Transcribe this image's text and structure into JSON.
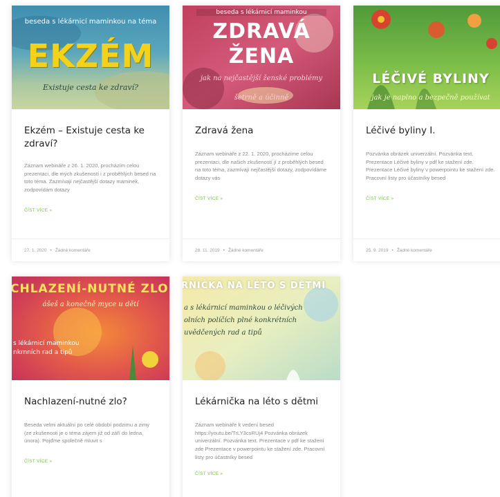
{
  "posts": [
    {
      "image": {
        "line1": "beseda s lékárnicí maminkou na téma",
        "big": "EKZÉM",
        "line2": "Existuje cesta ke zdraví?"
      },
      "title": "Ekzém – Existuje cesta ke zdraví?",
      "excerpt": "Záznam webináře z 26. 1. 2020, procházím celou prezentaci, dle mých zkušeností i z proběhlých besed na toto téma. Zazmívají nejčastější dotazy maminek, zodpovídám dotazy",
      "read_more": "ČÍST VÍCE »",
      "date": "27. 1. 2020",
      "comments": "Žádné komentáře"
    },
    {
      "image": {
        "line1": "beseda s lékárnicí maminkou",
        "big1": "ZDRAVÁ",
        "big2": "ŽENA",
        "line2": "jak na nejčastější ženské problémy",
        "line3": "šetrně a účinně"
      },
      "title": "Zdravá žena",
      "excerpt": "Záznam webináře z 22. 1. 2020, procházíme celou prezentaci, dle našich zkušeností jí z proběhlých besed na toto téma, zazmívají nejčastější dotazy, zodpovídáme dotazy vás",
      "read_more": "ČÍST VÍCE »",
      "date": "28. 11. 2019",
      "comments": "Žádné komentáře"
    },
    {
      "image": {
        "big": "LÉČIVÉ BYLINY",
        "line2": "jak je naplno a bezpečně používat"
      },
      "title": "Léčivé byliny I.",
      "excerpt": "Pozvánka obrázek univerzální. Pozvánka text. Prezentace Léčivé byliny v pdf ke stažení zde. Prezentace Léčivé byliny v powerpointu ke stažení zde. Pracovní listy pro účastníky besed",
      "read_more": "ČÍST VÍCE »",
      "date": "25. 9. 2019",
      "comments": "Žádné komentáře"
    },
    {
      "image": {
        "big": "CHLAZENÍ-NUTNÉ ZLO",
        "line2": "ášeš a konečně myce u dětí",
        "line3": "s lékárnicí maminkou",
        "line4": "nkrnních rad a tipů"
      },
      "title": "Nachlazení-nutné zlo?",
      "excerpt": "Beseda velmi aktuální po celé období podzimu a zimy (ze zkušenosti je o téma zájem již od září do ledna, února). Pojďme společně mluvit s",
      "read_more": "ČÍST VÍCE »",
      "date": "",
      "comments": ""
    },
    {
      "image": {
        "big": "RNIČKA NA LÉTO S DĚTMI",
        "line2": "a s lékárnicí maminkou o léčivých",
        "line3": "olních políčích plné konkrétních",
        "line4": "uvědčených rad a tipů"
      },
      "title": "Lékárnička na léto s dětmi",
      "excerpt": "Záznam webináře k vedení besed https://youtu.be/TrLY3csRUj4 Pozvánka obrázek univerzální. Pozvánka text. Prezentace v pdf ke stažení zde Prezentace v powerpointu ke stažení zde. Pracovní listy pro účastníky besed",
      "read_more": "ČÍST VÍCE »",
      "date": "",
      "comments": ""
    }
  ],
  "colors": {
    "accent_green": "#7bbf4a",
    "title": "#222222",
    "excerpt": "#8a8a8a",
    "meta": "#9a9a9a"
  }
}
